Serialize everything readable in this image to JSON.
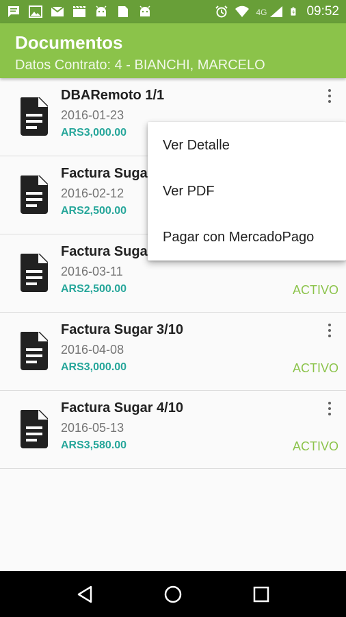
{
  "status_bar": {
    "time": "09:52",
    "network": "4G",
    "left_icons": [
      "message-icon",
      "image-icon",
      "gmail-icon",
      "clapperboard-icon",
      "android-icon",
      "file-icon",
      "android-icon"
    ],
    "right_icons": [
      "alarm-icon",
      "wifi-icon",
      "signal-icon",
      "battery-icon"
    ]
  },
  "app_bar": {
    "title": "Documentos",
    "subtitle": "Datos Contrato: 4 - BIANCHI, MARCELO",
    "background": "#8bc34a"
  },
  "documents": [
    {
      "title": "DBARemoto 1/1",
      "date": "2016-01-23",
      "amount": "ARS3,000.00",
      "status": ""
    },
    {
      "title": "Factura Suga",
      "date": "2016-02-12",
      "amount": "ARS2,500.00",
      "status": ""
    },
    {
      "title": "Factura Suga",
      "date": "2016-03-11",
      "amount": "ARS2,500.00",
      "status": "ACTIVO"
    },
    {
      "title": "Factura Sugar 3/10",
      "date": "2016-04-08",
      "amount": "ARS3,000.00",
      "status": "ACTIVO"
    },
    {
      "title": "Factura Sugar 4/10",
      "date": "2016-05-13",
      "amount": "ARS3,580.00",
      "status": "ACTIVO"
    }
  ],
  "popup_menu": {
    "items": [
      {
        "label": "Ver Detalle"
      },
      {
        "label": "Ver PDF"
      },
      {
        "label": "Pagar con MercadoPago"
      }
    ]
  },
  "nav_bar": {
    "buttons": [
      "back-icon",
      "home-icon",
      "recents-icon"
    ]
  },
  "colors": {
    "primary": "#8bc34a",
    "primary_dark": "#689f38",
    "amount": "#26a69a",
    "status": "#8bc34a"
  }
}
